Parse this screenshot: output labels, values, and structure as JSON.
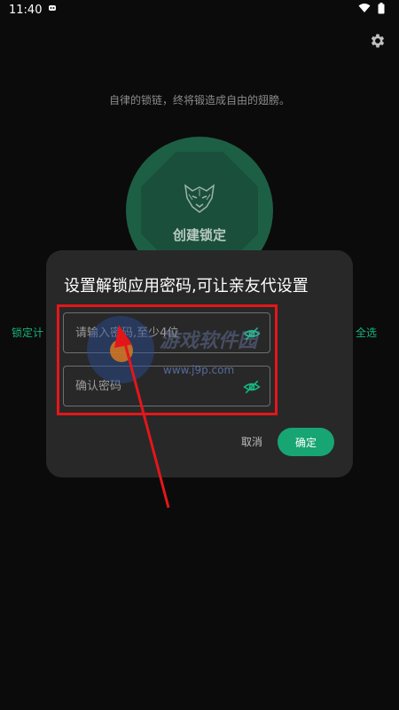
{
  "status_bar": {
    "time": "11:40"
  },
  "slogan": "自律的锁链，终将锻造成自由的翅膀。",
  "lock_button": {
    "label": "创建锁定"
  },
  "side_left": "锁定计",
  "side_right": "全选",
  "dialog": {
    "title": "设置解锁应用密码,可让亲友代设置",
    "password_placeholder": "请输入密码,至少4位",
    "confirm_placeholder": "确认密码",
    "cancel_label": "取消",
    "ok_label": "确定"
  },
  "watermark": {
    "brand": "游戏软件园",
    "url": "www.j9p.com"
  },
  "colors": {
    "accent": "#17a574",
    "highlight": "#e4161a"
  },
  "icons": {
    "settings": "gear-icon",
    "visibility": "eye-off-icon",
    "wifi": "wifi-icon",
    "battery": "battery-icon"
  }
}
